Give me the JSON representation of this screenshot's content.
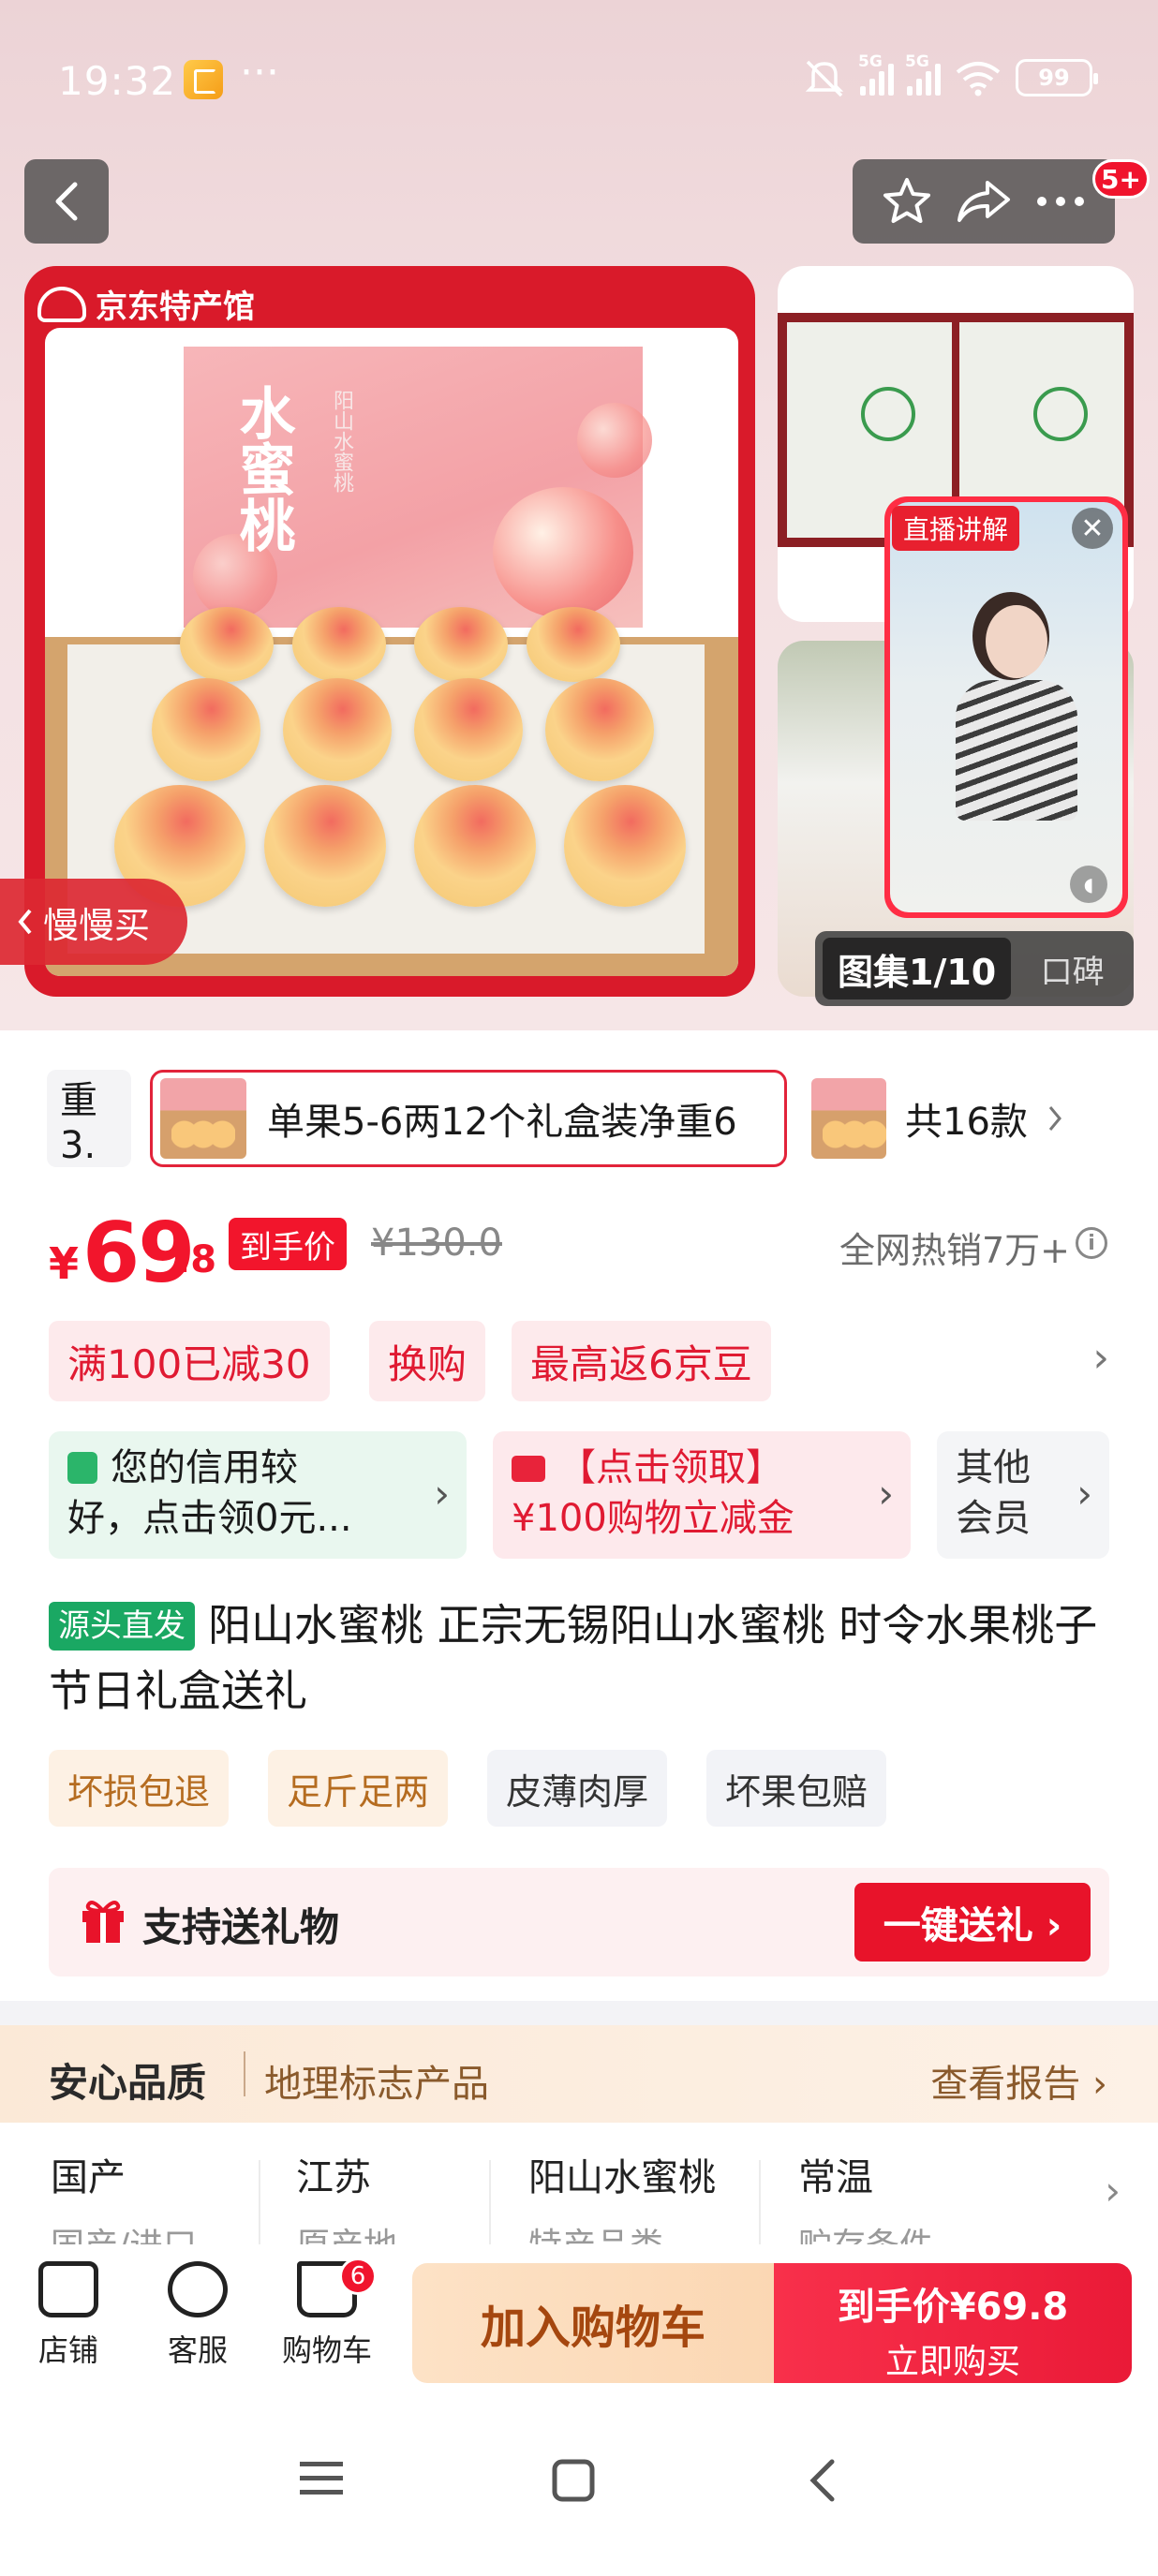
{
  "status_bar": {
    "time": "19:32",
    "more": "···",
    "network_1": "5G",
    "network_2": "5G",
    "battery": "99"
  },
  "header": {
    "cart_badge": "5+"
  },
  "gallery": {
    "store_logo": "京东特产馆",
    "box_title": "水蜜桃",
    "box_subtitle": "阳山水蜜桃",
    "slow_buy": "慢慢买",
    "live_tag": "直播讲解",
    "count": "图集1/10",
    "review": "口碑"
  },
  "variants": {
    "prev_label": "重3.",
    "selected_label": "单果5-6两12个礼盒装净重6",
    "total_label": "共16款"
  },
  "price": {
    "currency": "¥",
    "integer": "69",
    "decimal": ".8",
    "tag": "到手价",
    "original": "¥130.0",
    "sales": "全网热销7万+"
  },
  "coupons": [
    "满100已减30",
    "换购",
    "最高返6京豆"
  ],
  "promos": {
    "credit_line1": "您的信用较",
    "credit_line2": "好，点击领0元...",
    "cash_line1": "【点击领取】",
    "cash_line2": "¥100购物立减金",
    "member_line1": "其他",
    "member_line2": "会员"
  },
  "product": {
    "source_tag": "源头直发",
    "title": "阳山水蜜桃 正宗无锡阳山水蜜桃 时令水果桃子 节日礼盒送礼"
  },
  "feature_tags": [
    "坏损包退",
    "足斤足两",
    "皮薄肉厚",
    "坏果包赔"
  ],
  "gift": {
    "label": "支持送礼物",
    "button": "一键送礼 ›"
  },
  "quality": {
    "title": "安心品质",
    "subtitle": "地理标志产品",
    "link": "查看报告 ›"
  },
  "specs": [
    {
      "value": "国产",
      "key": "国产/进口"
    },
    {
      "value": "江苏",
      "key": "原产地"
    },
    {
      "value": "阳山水蜜桃",
      "key": "特产品类"
    },
    {
      "value": "常温",
      "key": "贮存条件"
    }
  ],
  "bottom_bar": {
    "store": "店铺",
    "service": "客服",
    "cart": "购物车",
    "cart_count": "6",
    "add_to_cart": "加入购物车",
    "buy_price": "到手价¥69.8",
    "buy_now": "立即购买"
  },
  "colors": {
    "brand_red": "#f2152c",
    "source_green": "#1aa863",
    "quality_brown": "#8a5a2c"
  }
}
